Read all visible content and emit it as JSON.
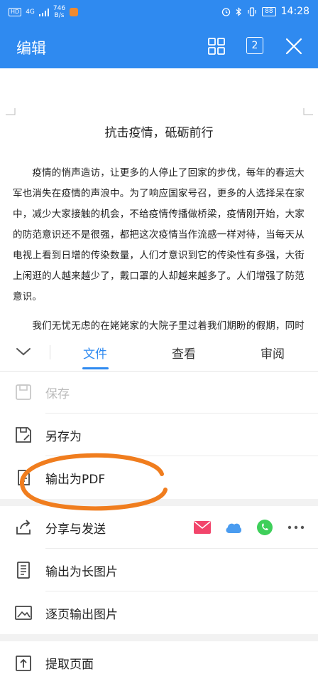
{
  "status_bar": {
    "hd": "HD",
    "network": "4G",
    "speed_value": "746",
    "speed_unit": "B/s",
    "battery": "88",
    "time": "14:28"
  },
  "app_bar": {
    "title": "编辑",
    "page_count": "2"
  },
  "document": {
    "title": "抗击疫情，砥砺前行",
    "paragraphs": [
      "　　疫情的悄声造访，让更多的人停止了回家的步伐，每年的春运大军也消失在疫情的声浪中。为了响应国家号召，更多的人选择呆在家中，减少大家接触的机会，不给疫情传播做桥梁，疫情刚开始，大家的防范意识还不是很强，都把这次疫情当作流感一样对待，当每天从电视上看到日增的传染数量，人们才意识到它的传染性有多强，大街上闲逛的人越来越少了，戴口罩的人却越来越多了。人们增强了防范意识。",
      "　　我们无忧无虑的在姥姥家的大院子里过着我们期盼的假期，同时我"
    ]
  },
  "tabs": [
    {
      "label": "文件",
      "active": true
    },
    {
      "label": "查看",
      "active": false
    },
    {
      "label": "审阅",
      "active": false
    }
  ],
  "menu": {
    "save": "保存",
    "save_as": "另存为",
    "export_pdf": "输出为PDF",
    "share": "分享与发送",
    "export_long_image": "输出为长图片",
    "export_page_images": "逐页输出图片",
    "extract_pages": "提取页面"
  },
  "share_icons": [
    "mail-icon",
    "cloud-icon",
    "whatsapp-icon",
    "more-icon"
  ],
  "colors": {
    "accent": "#2f8af0",
    "annotation": "#f07d1e",
    "mail": "#f2456b",
    "cloud": "#4a9cf0",
    "whatsapp": "#3ecf5a"
  }
}
